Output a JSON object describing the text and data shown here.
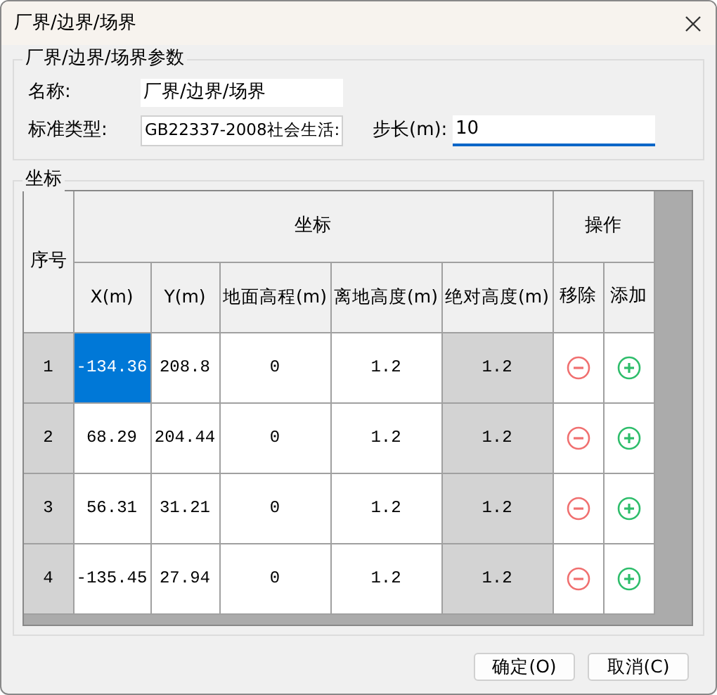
{
  "window": {
    "title": "厂界/边界/场界"
  },
  "params": {
    "title": "厂界/边界/场界参数",
    "name_label": "名称:",
    "name_value": "厂界/边界/场界",
    "type_label": "标准类型:",
    "type_value": "GB22337-2008社会生活:",
    "step_label": "步长(m):",
    "step_value": "10"
  },
  "coords": {
    "title": "坐标",
    "index_header": "序号",
    "coord_header": "坐标",
    "ops_header": "操作",
    "columns": [
      {
        "label": "X(m)",
        "kind": "editable"
      },
      {
        "label": "Y(m)",
        "kind": "editable"
      },
      {
        "label": "地面高程(m)",
        "kind": "editable"
      },
      {
        "label": "离地高度(m)",
        "kind": "editable"
      },
      {
        "label": "绝对高度(m)",
        "kind": "readonly"
      }
    ],
    "op_columns": [
      "移除",
      "添加"
    ],
    "rows": [
      {
        "index": "1",
        "cells": [
          {
            "text": "-134.36",
            "selected": true
          },
          {
            "text": "208.8",
            "selected": false
          },
          {
            "text": "0",
            "selected": false
          },
          {
            "text": "1.2",
            "selected": false
          },
          {
            "text": "1.2",
            "selected": false
          }
        ]
      },
      {
        "index": "2",
        "cells": [
          {
            "text": "68.29",
            "selected": false
          },
          {
            "text": "204.44",
            "selected": false
          },
          {
            "text": "0",
            "selected": false
          },
          {
            "text": "1.2",
            "selected": false
          },
          {
            "text": "1.2",
            "selected": false
          }
        ]
      },
      {
        "index": "3",
        "cells": [
          {
            "text": "56.31",
            "selected": false
          },
          {
            "text": "31.21",
            "selected": false
          },
          {
            "text": "0",
            "selected": false
          },
          {
            "text": "1.2",
            "selected": false
          },
          {
            "text": "1.2",
            "selected": false
          }
        ]
      },
      {
        "index": "4",
        "cells": [
          {
            "text": "-135.45",
            "selected": false
          },
          {
            "text": "27.94",
            "selected": false
          },
          {
            "text": "0",
            "selected": false
          },
          {
            "text": "1.2",
            "selected": false
          },
          {
            "text": "1.2",
            "selected": false
          }
        ]
      }
    ]
  },
  "buttons": [
    "确定(O)",
    "取消(C)"
  ]
}
